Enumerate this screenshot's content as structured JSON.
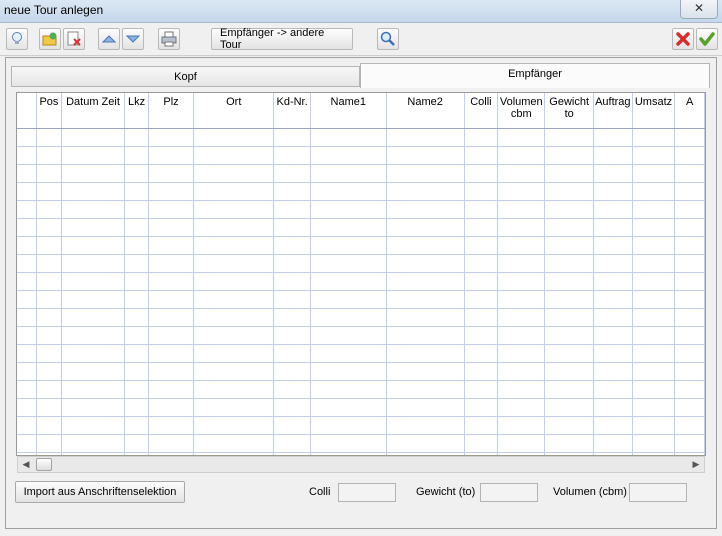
{
  "window": {
    "title": "neue Tour anlegen",
    "close_glyph": "✕"
  },
  "toolbar": {
    "move_recipient_label": "Empfänger -> andere Tour",
    "icons": [
      "lightbulb-icon",
      "folder-add-icon",
      "delete-document-icon",
      "arrow-up-icon",
      "arrow-down-icon",
      "print-icon",
      "search-icon",
      "cancel-icon",
      "confirm-icon"
    ]
  },
  "tabs": [
    {
      "label": "Kopf",
      "active": false
    },
    {
      "label": "Empfänger",
      "active": true
    }
  ],
  "grid": {
    "columns": [
      "",
      "Pos",
      "Datum Zeit",
      "Lkz",
      "Plz",
      "Ort",
      "Kd-Nr.",
      "Name1",
      "Name2",
      "Colli",
      "Volumen cbm",
      "Gewicht to",
      "Auftrag",
      "Umsatz",
      "A"
    ],
    "empty_rows": 19
  },
  "scrollbar": {
    "left_arrow": "◀",
    "right_arrow": "▶"
  },
  "footer": {
    "import_button": "Import aus Anschriftenselektion",
    "colli_label": "Colli",
    "colli_value": "",
    "weight_label": "Gewicht (to)",
    "weight_value": "",
    "volume_label": "Volumen (cbm)",
    "volume_value": ""
  }
}
